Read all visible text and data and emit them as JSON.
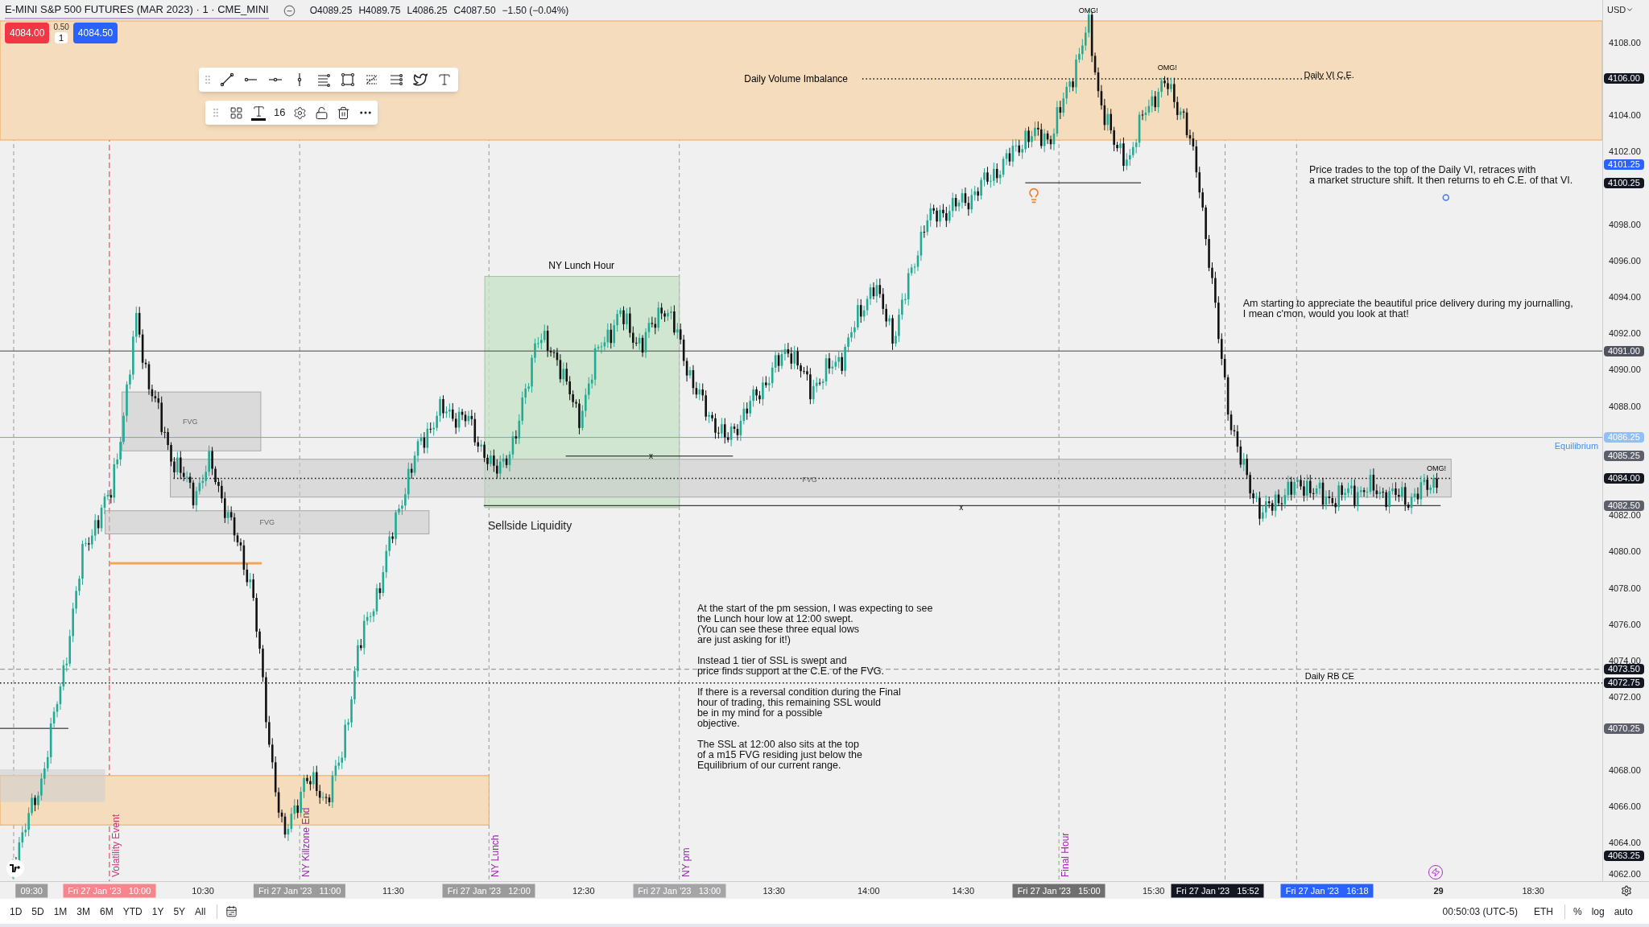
{
  "header": {
    "title": "E-MINI S&P 500 FUTURES (MAR 2023) · 1 · CME_MINI",
    "ohlc": [
      "O4089.25",
      "H4089.75",
      "L4086.25",
      "C4087.50",
      "−1.50 (−0.04%)"
    ]
  },
  "trade": {
    "sell": "4084.00",
    "spread": "0.50",
    "quantity": "1",
    "buy": "4084.50"
  },
  "drawing_toolbar": {
    "font_size": "16"
  },
  "chart": {
    "labels": [
      "Daily Volume Imbalance",
      "Daily VI C.E.",
      "OMG!",
      "OMG!",
      "NY Lunch Hour",
      "FVG",
      "FVG",
      "FVG",
      "x",
      "x",
      "Sellside Liquidity",
      "Equilibrium",
      "OMG!",
      "Daily RB CE"
    ],
    "session_labels": [
      {
        "text": "Volatility Event",
        "color": "#d0307a"
      },
      {
        "text": "NY Killzone End",
        "color": "#9c27b0"
      },
      {
        "text": "NY Lunch",
        "color": "#9c27b0"
      },
      {
        "text": "NY pm",
        "color": "#9c27b0"
      },
      {
        "text": "Final Hour",
        "color": "#9c27b0"
      }
    ],
    "notes": [
      {
        "paragraphs": [
          "At the start of the pm session, I was expecting to see\nthe Lunch hour low at 12:00 swept.\n(You can see these three equal lows\nare just asking for it!)",
          "Instead 1 tier of SSL is swept and\nprice finds support at the C.E. of the FVG.",
          "If there is a reversal condition during the Final\nhour of trading, this remaining SSL would\nbe in my mind for a possible\nobjective.",
          "The SSL at 12:00 also sits at the top\nof a m15 FVG residing just below the\nEquilibrium of our current range."
        ]
      },
      {
        "paragraphs": [
          "Price trades to the top of the Daily VI, retraces with\na market structure shift. It then returns to eh C.E. of that VI."
        ]
      },
      {
        "paragraphs": [
          "Am starting to appreciate the beautiful price delivery during my journalling,\nI mean c'mon, would you look at that!"
        ]
      }
    ]
  },
  "price_axis": {
    "currency": "USD",
    "ticks": [
      "4108.00",
      "4104.00",
      "4102.00",
      "4098.00",
      "4096.00",
      "4094.00",
      "4092.00",
      "4090.00",
      "4088.00",
      "4082.00",
      "4080.00",
      "4078.00",
      "4076.00",
      "4074.00",
      "4072.00",
      "4068.00",
      "4066.00",
      "4064.00",
      "4062.00"
    ],
    "markers": [
      {
        "text": "4106.00",
        "color": "#131722"
      },
      {
        "text": "4101.25",
        "color": "#2962ff"
      },
      {
        "text": "4100.25",
        "color": "#131722"
      },
      {
        "text": "4091.00",
        "color": "#50535e"
      },
      {
        "text": "4086.25",
        "color": "#90bff9"
      },
      {
        "text": "4085.25",
        "color": "#5d606b"
      },
      {
        "text": "4084.00",
        "color": "#131722"
      },
      {
        "text": "4082.50",
        "color": "#5d606b"
      },
      {
        "text": "4073.50",
        "color": "#131722"
      },
      {
        "text": "4072.75",
        "color": "#131722"
      },
      {
        "text": "4070.25",
        "color": "#5d606b"
      },
      {
        "text": "4063.25",
        "color": "#131722"
      }
    ]
  },
  "time_axis": {
    "items": [
      {
        "kind": "marker",
        "text": "09:30",
        "color": "#9b9b9b"
      },
      {
        "kind": "marker",
        "text": "Fri 27 Jan '23   10:00",
        "color": "#f7858d"
      },
      {
        "kind": "plain",
        "text": "10:30"
      },
      {
        "kind": "marker",
        "text": "Fri 27 Jan '23   11:00",
        "color": "#9b9b9b"
      },
      {
        "kind": "plain",
        "text": "11:30"
      },
      {
        "kind": "marker",
        "text": "Fri 27 Jan '23   12:00",
        "color": "#9b9b9b"
      },
      {
        "kind": "plain",
        "text": "12:30"
      },
      {
        "kind": "marker",
        "text": "Fri 27 Jan '23   13:00",
        "color": "#a5a5a8"
      },
      {
        "kind": "plain",
        "text": "13:30"
      },
      {
        "kind": "plain",
        "text": "14:00"
      },
      {
        "kind": "plain",
        "text": "14:30"
      },
      {
        "kind": "marker",
        "text": "Fri 27 Jan '23   15:00",
        "color": "#6f6f6f"
      },
      {
        "kind": "plain",
        "text": "15:30"
      },
      {
        "kind": "marker",
        "text": "Fri 27 Jan '23   15:52",
        "color": "#131722"
      },
      {
        "kind": "marker",
        "text": "Fri 27 Jan '23   16:18",
        "color": "#2962ff"
      },
      {
        "kind": "date",
        "text": "29"
      },
      {
        "kind": "plain",
        "text": "18:30"
      }
    ]
  },
  "bottom_bar": {
    "ranges": [
      "1D",
      "5D",
      "1M",
      "3M",
      "6M",
      "YTD",
      "1Y",
      "5Y",
      "All"
    ],
    "clock": "00:50:03 (UTC-5)",
    "session": "ETH",
    "scale_options": [
      "%",
      "log",
      "auto"
    ]
  }
}
